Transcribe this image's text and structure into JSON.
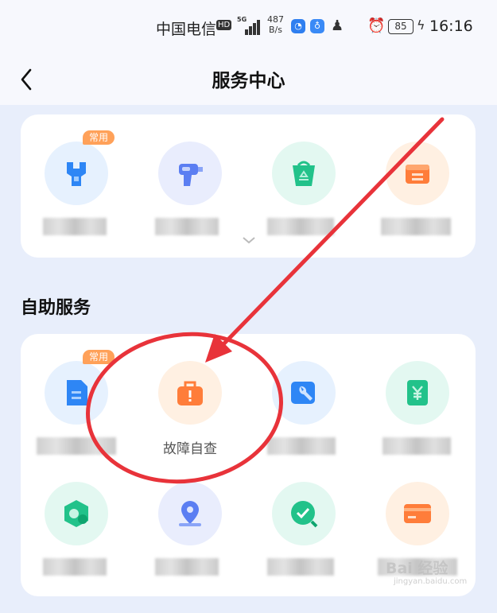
{
  "status_bar": {
    "carrier": "中国电信",
    "hd": "HD",
    "net_speed_value": "487",
    "net_speed_unit": "B/s",
    "battery": "85",
    "time": "16:16"
  },
  "header": {
    "title": "服务中心"
  },
  "top_services": {
    "items": [
      {
        "icon": "wrench-icon",
        "badge": "常用",
        "color": "#2e86f5",
        "bg": "#e6f1fe"
      },
      {
        "icon": "drill-icon",
        "badge": "",
        "color": "#5b7ef2",
        "bg": "#e9edfd"
      },
      {
        "icon": "recycle-bin-icon",
        "badge": "",
        "color": "#22c28a",
        "bg": "#e3f8f1"
      },
      {
        "icon": "box-icon",
        "badge": "",
        "color": "#ff7d3a",
        "bg": "#fff0e2"
      }
    ]
  },
  "self_service": {
    "title": "自助服务",
    "items": [
      {
        "icon": "document-icon",
        "badge": "常用",
        "label": "",
        "color": "#2e86f5",
        "bg": "#e6f1fe"
      },
      {
        "icon": "toolbox-icon",
        "badge": "",
        "label": "故障自查",
        "color": "#ff7d3a",
        "bg": "#fff0e2"
      },
      {
        "icon": "repair-icon",
        "badge": "",
        "label": "",
        "color": "#2e86f5",
        "bg": "#e6f1fe"
      },
      {
        "icon": "yuan-icon",
        "badge": "",
        "label": "",
        "color": "#22c28a",
        "bg": "#e3f8f1"
      },
      {
        "icon": "hex-coin-icon",
        "badge": "",
        "label": "",
        "color": "#22c28a",
        "bg": "#e3f8f1"
      },
      {
        "icon": "location-pin-icon",
        "badge": "",
        "label": "",
        "color": "#5b7ef2",
        "bg": "#e9edfd"
      },
      {
        "icon": "clock-check-icon",
        "badge": "",
        "label": "",
        "color": "#22c28a",
        "bg": "#e3f8f1"
      },
      {
        "icon": "card-icon",
        "badge": "",
        "label": "",
        "color": "#ff7d3a",
        "bg": "#fff0e2"
      }
    ]
  },
  "watermark": {
    "brand": "Bai 经验",
    "url": "jingyan.baidu.com"
  },
  "annotation_color": "#e8333a"
}
